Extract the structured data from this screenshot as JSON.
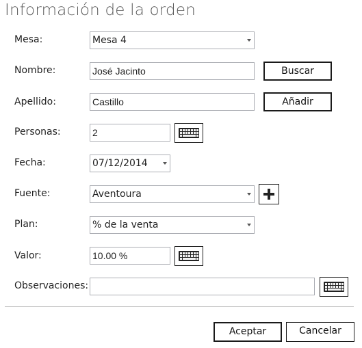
{
  "window": {
    "title": "Información de la orden"
  },
  "form": {
    "mesa": {
      "label": "Mesa:",
      "value": "Mesa 4"
    },
    "nombre": {
      "label": "Nombre:",
      "value": "José Jacinto",
      "button": "Buscar"
    },
    "apellido": {
      "label": "Apellido:",
      "value": "Castillo",
      "button": "Añadir"
    },
    "personas": {
      "label": "Personas:",
      "value": "2"
    },
    "fecha": {
      "label": "Fecha:",
      "value": "07/12/2014"
    },
    "fuente": {
      "label": "Fuente:",
      "value": "Aventoura"
    },
    "plan": {
      "label": "Plan:",
      "value": "% de la venta"
    },
    "valor": {
      "label": "Valor:",
      "value": "10.00 %"
    },
    "observaciones": {
      "label": "Observaciones:",
      "value": ""
    }
  },
  "footer": {
    "accept": "Aceptar",
    "cancel": "Cancelar"
  },
  "icons": {
    "keyboard": "keyboard-icon",
    "add": "plus-icon",
    "dropdown": "chevron-down-icon"
  }
}
